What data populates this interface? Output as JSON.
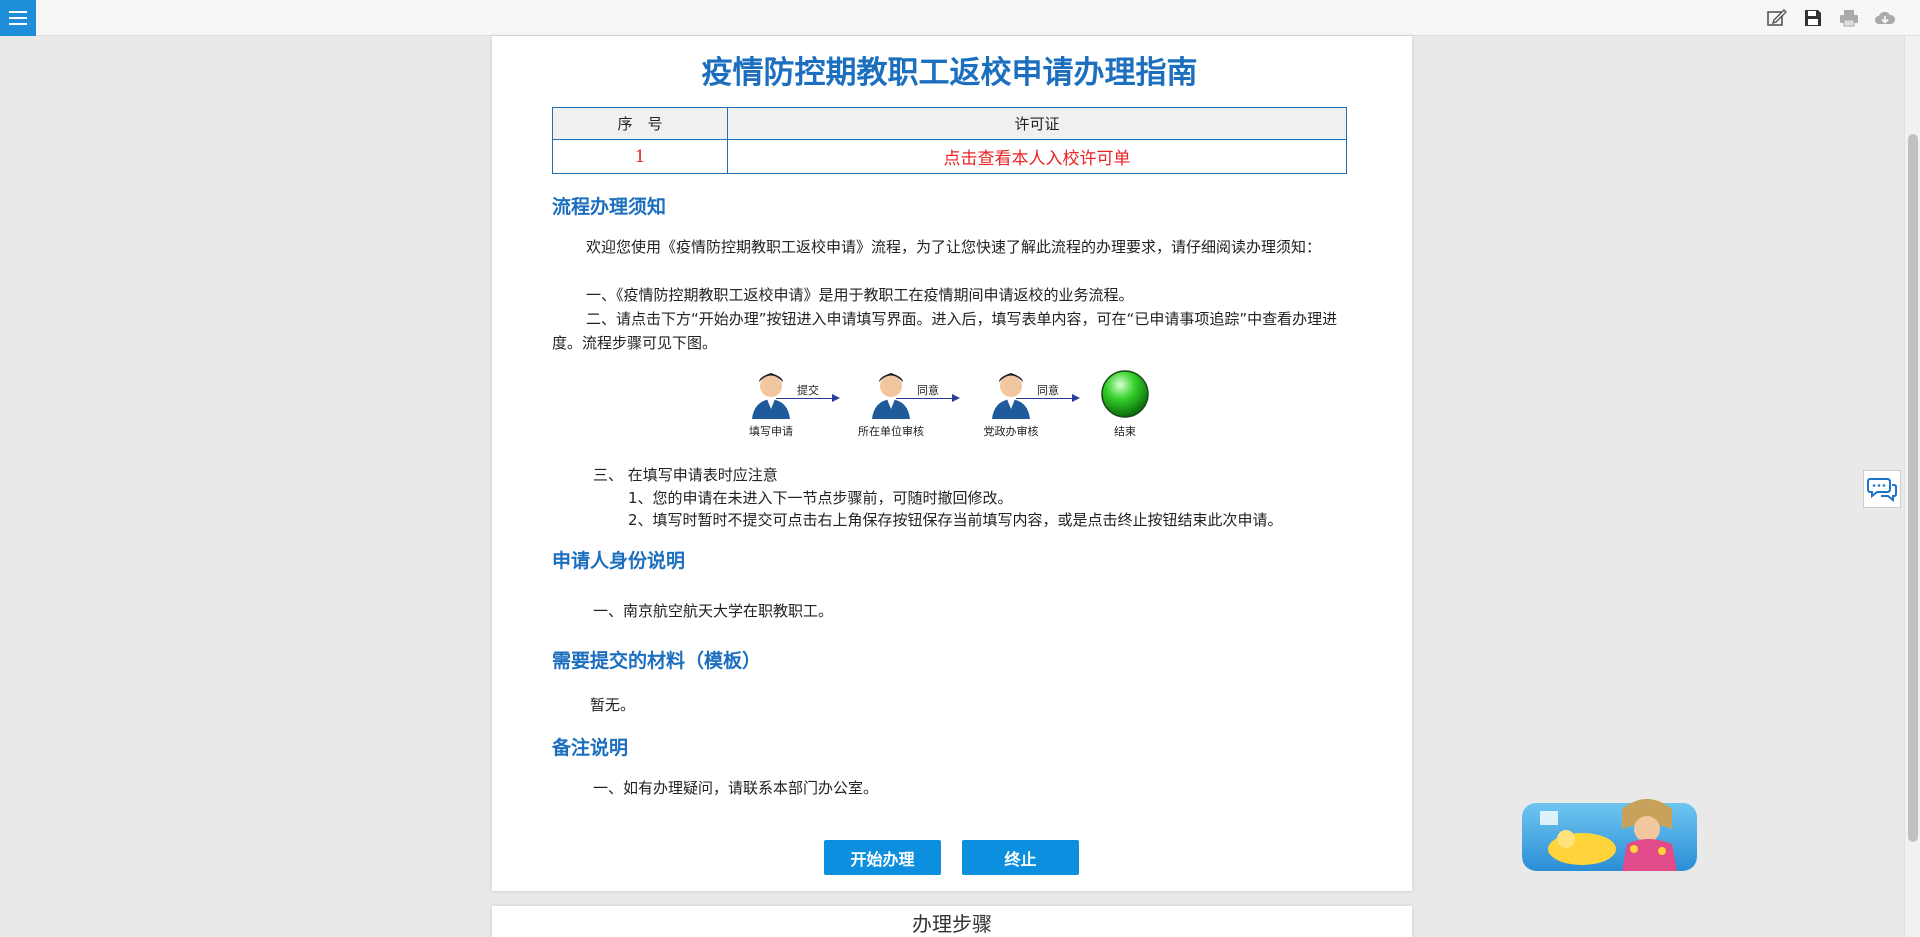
{
  "toolbar": {
    "menu": "menu",
    "tools": [
      "edit-icon",
      "save-icon",
      "print-icon",
      "cloud-download-icon"
    ]
  },
  "title": "疫情防控期教职工返校申请办理指南",
  "permit_table": {
    "headers": [
      "序　号",
      "许可证"
    ],
    "rows": [
      {
        "index": "1",
        "link": "点击查看本人入校许可单"
      }
    ]
  },
  "sections": {
    "process": {
      "heading": "流程办理须知",
      "intro": "欢迎您使用《疫情防控期教职工返校申请》流程，为了让您快速了解此流程的办理要求，请仔细阅读办理须知：",
      "item1": "一、《疫情防控期教职工返校申请》是用于教职工在疫情期间申请返校的业务流程。",
      "item2": "二、请点击下方“开始办理”按钮进入申请填写界面。进入后，填写表单内容，可在“已申请事项追踪”中查看办理进度。流程步骤可见下图。",
      "flow": {
        "nodes": [
          "填写申请",
          "所在单位审核",
          "党政办审核",
          "结束"
        ],
        "edges": [
          "提交",
          "同意",
          "同意"
        ]
      },
      "item3": "三、 在填写申请表时应注意",
      "item3_1": "1、您的申请在未进入下一节点步骤前，可随时撤回修改。",
      "item3_2": "2、填写时暂时不提交可点击右上角保存按钮保存当前填写内容，或是点击终止按钮结束此次申请。"
    },
    "identity": {
      "heading": "申请人身份说明",
      "item1": "一、南京航空航天大学在职教职工。"
    },
    "materials": {
      "heading": "需要提交的材料（模板）",
      "text": "暂无。"
    },
    "notes": {
      "heading": "备注说明",
      "item1": "一、如有办理疑问，请联系本部门办公室。"
    }
  },
  "buttons": {
    "start": "开始办理",
    "stop": "终止"
  },
  "steps_title": "办理步骤",
  "colors": {
    "accent": "#1c6fbf",
    "button": "#0d8fe0",
    "link": "#e82424"
  }
}
